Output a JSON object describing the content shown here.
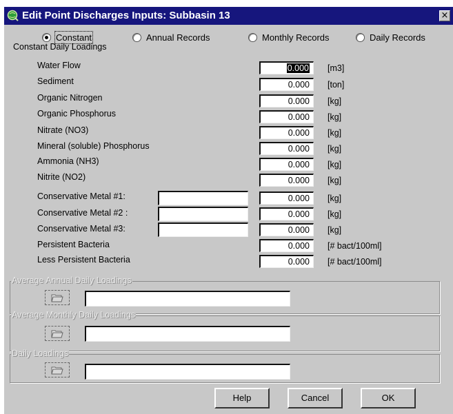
{
  "window": {
    "title": "Edit Point Discharges Inputs: Subbasin 13",
    "close_symbol": "×"
  },
  "mode_options": [
    {
      "label": "Constant",
      "checked": true
    },
    {
      "label": "Annual Records",
      "checked": false
    },
    {
      "label": "Monthly Records",
      "checked": false
    },
    {
      "label": "Daily Records",
      "checked": false
    }
  ],
  "constant_group": {
    "title": "Constant Daily Loadings",
    "rows": [
      {
        "label": "Water Flow",
        "value": "0.000",
        "unit": "[m3]"
      },
      {
        "label": "Sediment",
        "value": "0.000",
        "unit": "[ton]"
      },
      {
        "label": "Organic Nitrogen",
        "value": "0.000",
        "unit": "[kg]"
      },
      {
        "label": "Organic Phosphorus",
        "value": "0.000",
        "unit": "[kg]"
      },
      {
        "label": "Nitrate (NO3)",
        "value": "0.000",
        "unit": "[kg]"
      },
      {
        "label": "Mineral (soluble) Phosphorus",
        "value": "0.000",
        "unit": "[kg]"
      },
      {
        "label": "Ammonia (NH3)",
        "value": "0.000",
        "unit": "[kg]"
      },
      {
        "label": "Nitrite (NO2)",
        "value": "0.000",
        "unit": "[kg]"
      },
      {
        "label": "Conservative Metal #1:",
        "value": "0.000",
        "unit": "[kg]",
        "name_value": ""
      },
      {
        "label": "Conservative Metal #2 :",
        "value": "0.000",
        "unit": "[kg]",
        "name_value": ""
      },
      {
        "label": "Conservative Metal #3:",
        "value": "0.000",
        "unit": "[kg]",
        "name_value": ""
      },
      {
        "label": "Persistent Bacteria",
        "value": "0.000",
        "unit": "[# bact/100ml]"
      },
      {
        "label": "Less Persistent Bacteria",
        "value": "0.000",
        "unit": "[# bact/100ml]"
      }
    ]
  },
  "record_groups": [
    {
      "title": "Average Annual Daily Loadings",
      "file_value": ""
    },
    {
      "title": "Average Monthly Daily Loadings",
      "file_value": ""
    },
    {
      "title": "Daily Loadings",
      "file_value": ""
    }
  ],
  "buttons": {
    "help": "Help",
    "cancel": "Cancel",
    "ok": "OK"
  },
  "colors": {
    "titlebar": "#16167d",
    "dialog": "#c8c8c8"
  },
  "icons": {
    "title": "arcview-globe-icon",
    "browse": "open-folder-icon"
  }
}
